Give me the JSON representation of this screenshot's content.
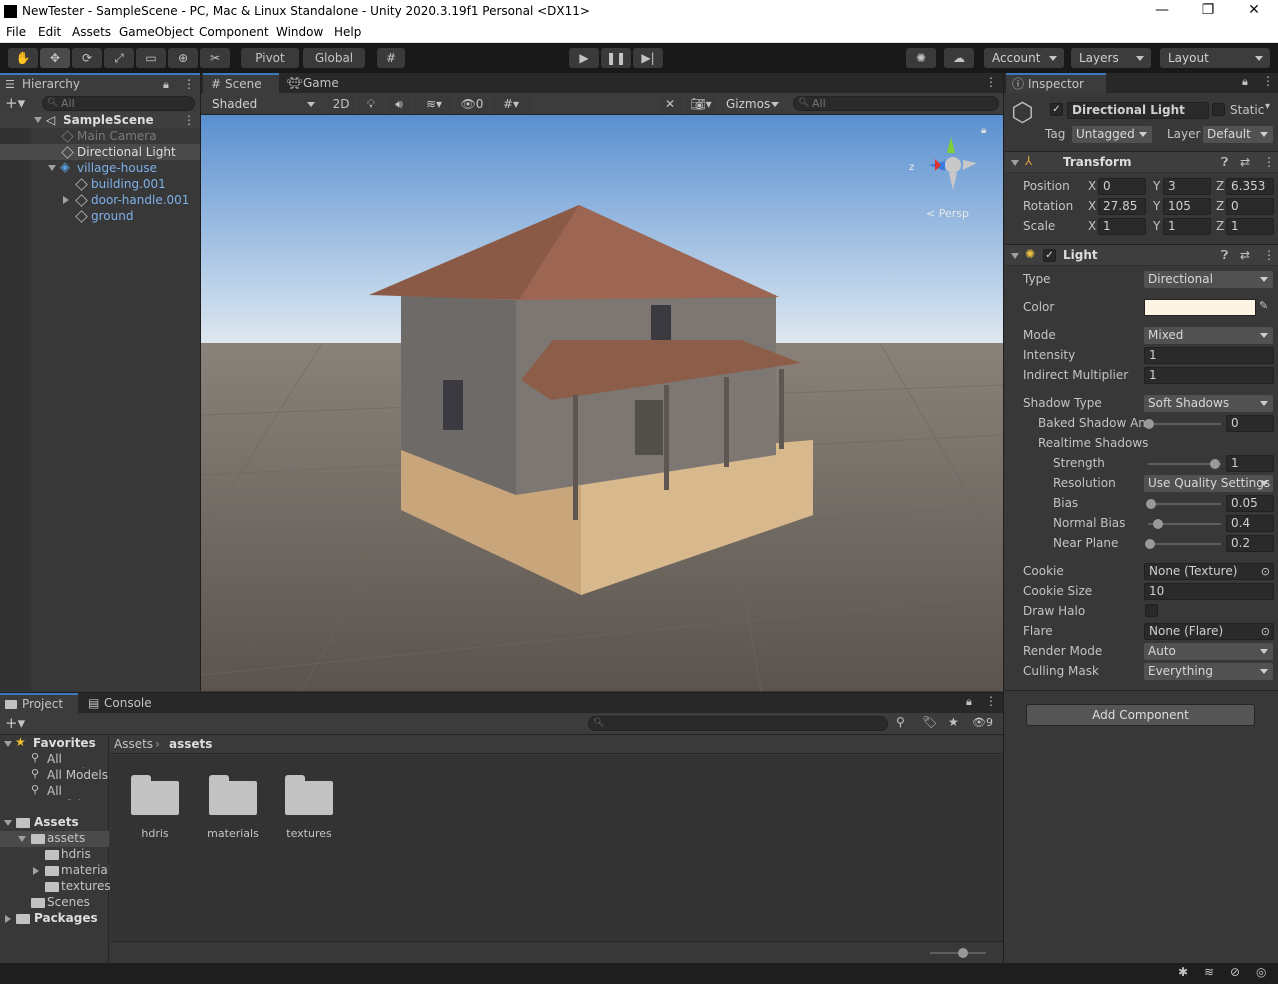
{
  "window": {
    "title": "NewTester - SampleScene - PC, Mac & Linux Standalone - Unity 2020.3.19f1 Personal <DX11>",
    "minimize": "—",
    "maximize": "❐",
    "close": "✕"
  },
  "menu": [
    "File",
    "Edit",
    "Assets",
    "GameObject",
    "Component",
    "Window",
    "Help"
  ],
  "toolbar": {
    "pivot": "Pivot",
    "global": "Global",
    "account": "Account",
    "layers": "Layers",
    "layout": "Layout"
  },
  "hierarchy": {
    "tab": "Hierarchy",
    "search_placeholder": "All",
    "scene": "SampleScene",
    "items": [
      "Main Camera",
      "Directional Light",
      "village-house",
      "building.001",
      "door-handle.001",
      "ground"
    ]
  },
  "scene": {
    "tabs": [
      "Scene",
      "Game"
    ],
    "shading": "Shaded",
    "mode2d": "2D",
    "hidden_count": "0",
    "gizmos": "Gizmos",
    "search_placeholder": "All",
    "persp": "< Persp",
    "axis_z": "z"
  },
  "inspector": {
    "tab": "Inspector",
    "object_name": "Directional Light",
    "static": "Static",
    "tag_label": "Tag",
    "tag": "Untagged",
    "layer_label": "Layer",
    "layer": "Default",
    "transform": {
      "title": "Transform",
      "rows": [
        {
          "label": "Position",
          "x": "0",
          "y": "3",
          "z": "6.353"
        },
        {
          "label": "Rotation",
          "x": "27.85",
          "y": "105",
          "z": "0"
        },
        {
          "label": "Scale",
          "x": "1",
          "y": "1",
          "z": "1"
        }
      ],
      "axes": [
        "X",
        "Y",
        "Z"
      ]
    },
    "light": {
      "title": "Light",
      "type_label": "Type",
      "type": "Directional",
      "color_label": "Color",
      "color": "#fdf4e3",
      "mode_label": "Mode",
      "mode": "Mixed",
      "intensity_label": "Intensity",
      "intensity": "1",
      "indirect_label": "Indirect Multiplier",
      "indirect": "1",
      "shadow_type_label": "Shadow Type",
      "shadow_type": "Soft Shadows",
      "baked_label": "Baked Shadow An",
      "baked": "0",
      "realtime_label": "Realtime Shadows",
      "strength_label": "Strength",
      "strength": "1",
      "resolution_label": "Resolution",
      "resolution": "Use Quality Settings",
      "bias_label": "Bias",
      "bias": "0.05",
      "normal_bias_label": "Normal Bias",
      "normal_bias": "0.4",
      "near_plane_label": "Near Plane",
      "near_plane": "0.2",
      "cookie_label": "Cookie",
      "cookie": "None (Texture)",
      "cookie_size_label": "Cookie Size",
      "cookie_size": "10",
      "draw_halo_label": "Draw Halo",
      "flare_label": "Flare",
      "flare": "None (Flare)",
      "render_mode_label": "Render Mode",
      "render_mode": "Auto",
      "culling_label": "Culling Mask",
      "culling": "Everything"
    },
    "add_component": "Add Component"
  },
  "project": {
    "tabs": [
      "Project",
      "Console"
    ],
    "hidden_count": "9",
    "favorites": "Favorites",
    "fav_items": [
      "All Materia",
      "All Models",
      "All Prefabs"
    ],
    "assets_root": "Assets",
    "tree": [
      "assets",
      "hdris",
      "materials",
      "textures",
      "Scenes"
    ],
    "packages": "Packages",
    "breadcrumb_root": "Assets",
    "breadcrumb_current": "assets",
    "folders": [
      "hdris",
      "materials",
      "textures"
    ]
  }
}
